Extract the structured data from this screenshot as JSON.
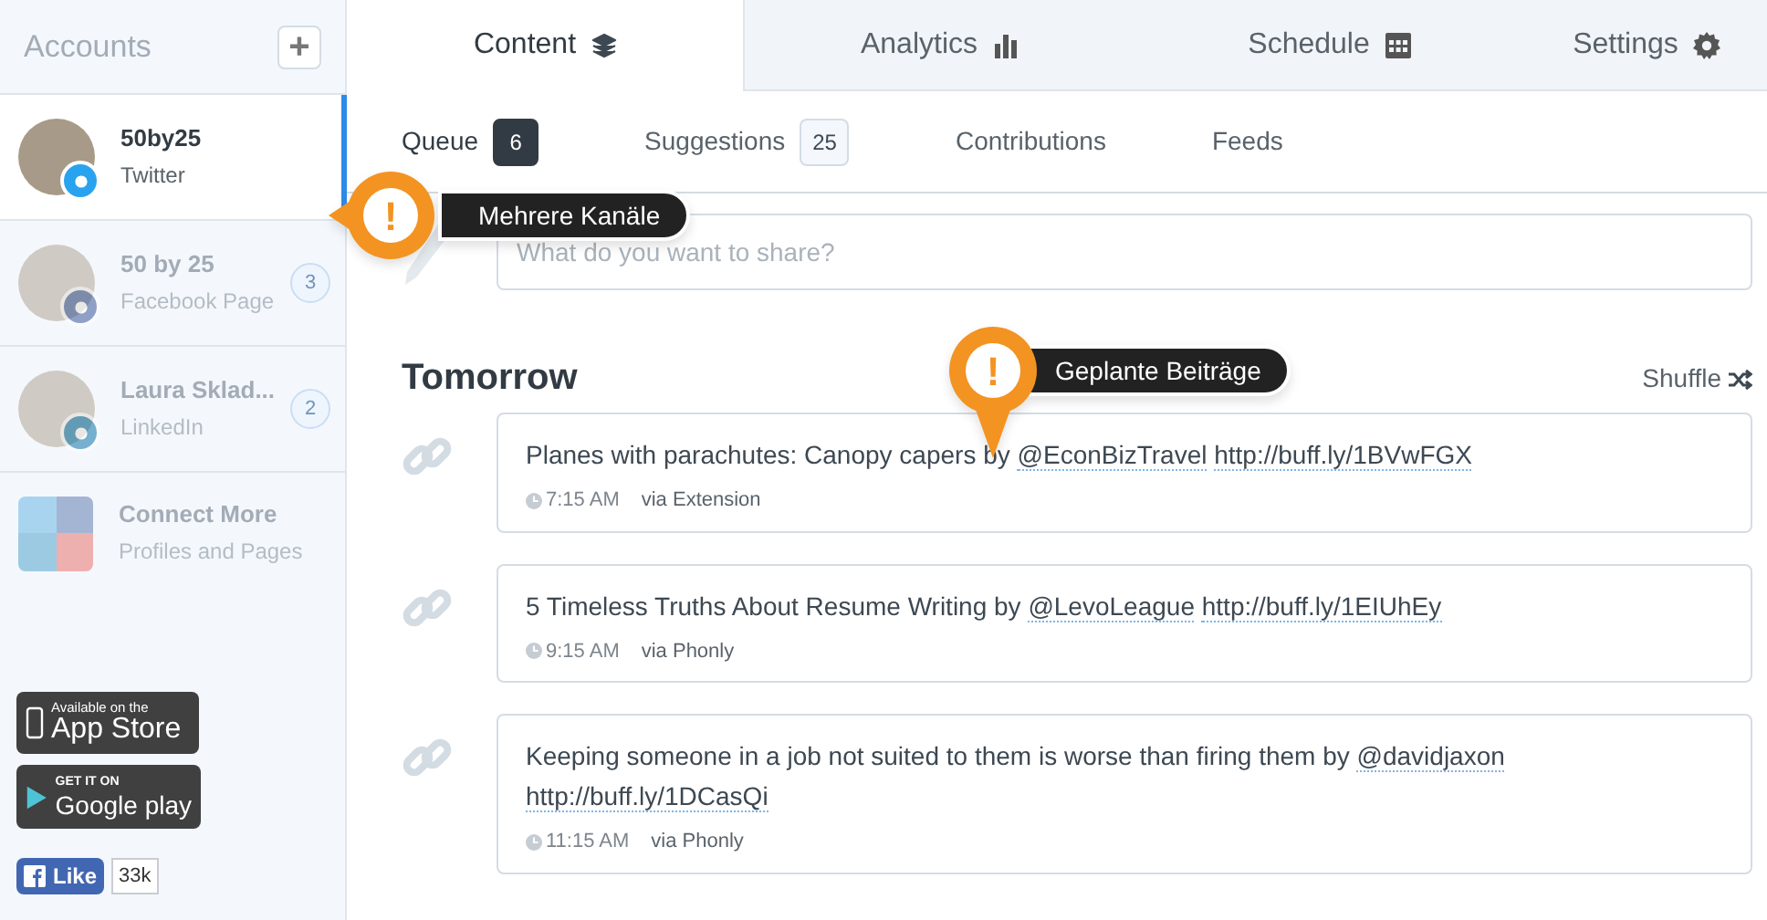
{
  "sidebar": {
    "title": "Accounts",
    "add_label": "+",
    "accounts": [
      {
        "name": "50by25",
        "network": "Twitter",
        "kind": "twitter",
        "selected": true
      },
      {
        "name": "50 by 25",
        "network": "Facebook Page",
        "kind": "facebook",
        "selected": false,
        "count": "3"
      },
      {
        "name": "Laura Sklad...",
        "network": "LinkedIn",
        "kind": "linkedin",
        "selected": false,
        "count": "2"
      }
    ],
    "connect": {
      "title": "Connect More",
      "subtitle": "Profiles and Pages"
    },
    "app_store": {
      "small": "Available on the",
      "large": "App Store"
    },
    "google_play": {
      "small": "GET IT ON",
      "large": "Google play"
    },
    "like": {
      "label": "Like",
      "count": "33k"
    }
  },
  "tabs": [
    {
      "label": "Content",
      "kind": "layers",
      "selected": true
    },
    {
      "label": "Analytics",
      "kind": "chart",
      "selected": false
    },
    {
      "label": "Schedule",
      "kind": "calendar",
      "selected": false
    },
    {
      "label": "Settings",
      "kind": "gear",
      "selected": false
    }
  ],
  "subtabs": [
    {
      "label": "Queue",
      "count": "6",
      "selected": true
    },
    {
      "label": "Suggestions",
      "count": "25",
      "selected": false
    },
    {
      "label": "Contributions",
      "selected": false
    },
    {
      "label": "Feeds",
      "selected": false
    }
  ],
  "composer": {
    "placeholder": "What do you want to share?"
  },
  "callouts": [
    {
      "label": "Mehrere Kanäle",
      "mark": "!"
    },
    {
      "label": "Geplante Beiträge",
      "mark": "!"
    }
  ],
  "day": "Tomorrow",
  "shuffle": "Shuffle",
  "posts": [
    {
      "text": "Planes with parachutes: Canopy capers by",
      "mention": "@EconBizTravel",
      "link": "http://buff.ly/1BVwFGX",
      "time": "7:15 AM",
      "via": "via Extension"
    },
    {
      "text": "5 Timeless Truths About Resume Writing by",
      "mention": "@LevoLeague",
      "link": "http://buff.ly/1EIUhEy",
      "time": "9:15 AM",
      "via": "via Phonly"
    },
    {
      "text": "Keeping someone in a job not suited to them is worse than firing them by",
      "mention": "@davidjaxon",
      "link": "http://buff.ly/1DCasQi",
      "time": "11:15 AM",
      "via": "via Phonly"
    }
  ]
}
